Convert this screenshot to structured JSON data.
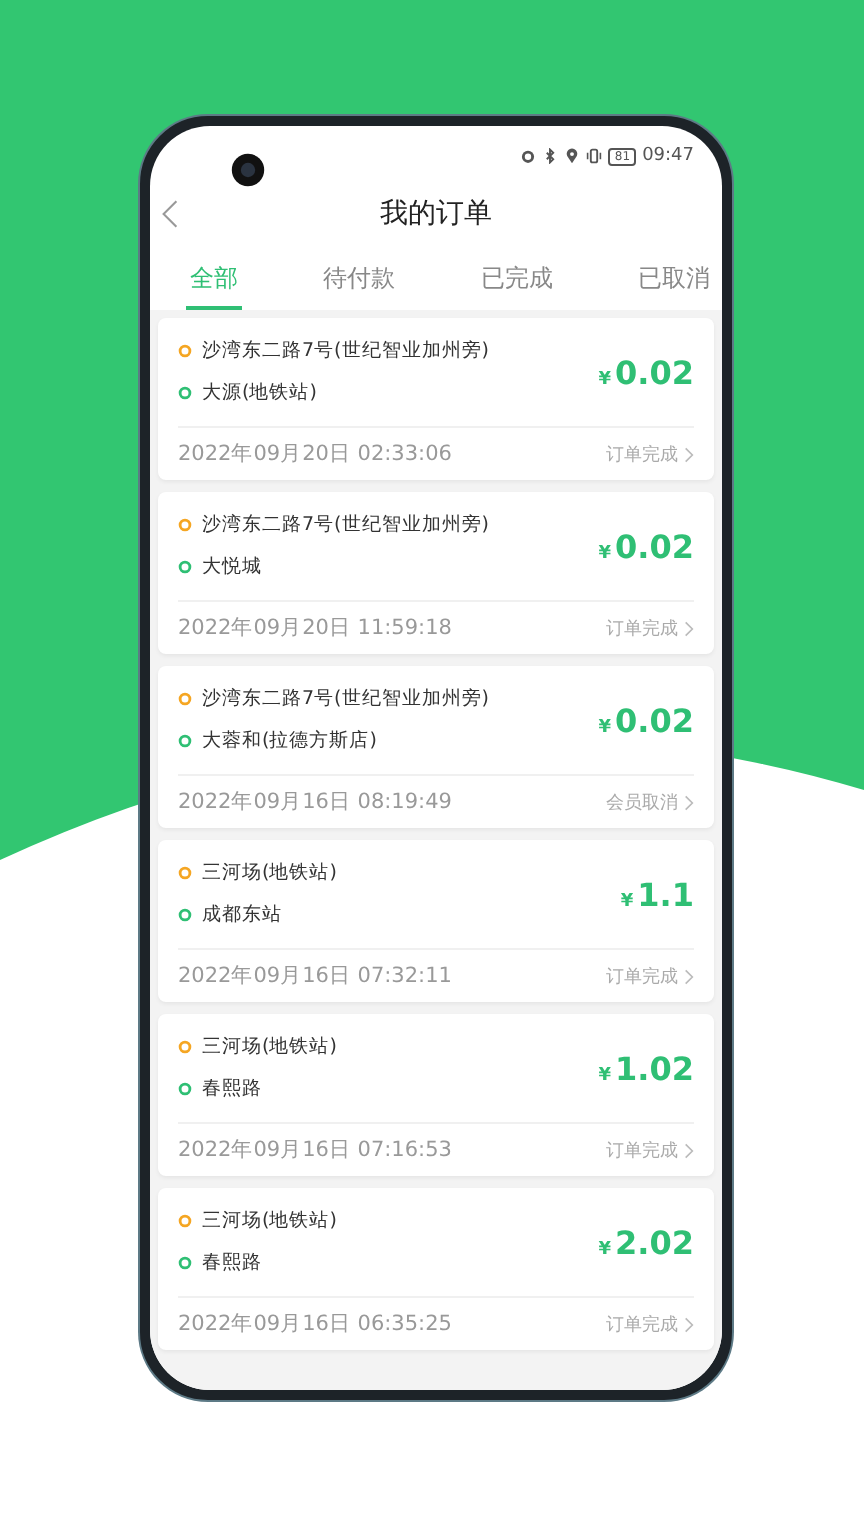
{
  "status_bar": {
    "battery": "81",
    "time": "09:47"
  },
  "header": {
    "title": "我的订单"
  },
  "tabs": [
    {
      "label": "全部",
      "selected": true
    },
    {
      "label": "待付款",
      "selected": false
    },
    {
      "label": "已完成",
      "selected": false
    },
    {
      "label": "已取消",
      "selected": false
    }
  ],
  "orders": [
    {
      "origin": "沙湾东二路7号(世纪智业加州旁)",
      "destination": "大源(地铁站)",
      "currency": "¥",
      "amount": "0.02",
      "datetime": "2022年09月20日 02:33:06",
      "status": "订单完成"
    },
    {
      "origin": "沙湾东二路7号(世纪智业加州旁)",
      "destination": "大悦城",
      "currency": "¥",
      "amount": "0.02",
      "datetime": "2022年09月20日 11:59:18",
      "status": "订单完成"
    },
    {
      "origin": "沙湾东二路7号(世纪智业加州旁)",
      "destination": "大蓉和(拉德方斯店)",
      "currency": "¥",
      "amount": "0.02",
      "datetime": "2022年09月16日 08:19:49",
      "status": "会员取消"
    },
    {
      "origin": "三河场(地铁站)",
      "destination": "成都东站",
      "currency": "¥",
      "amount": "1.1",
      "datetime": "2022年09月16日 07:32:11",
      "status": "订单完成"
    },
    {
      "origin": "三河场(地铁站)",
      "destination": "春熙路",
      "currency": "¥",
      "amount": "1.02",
      "datetime": "2022年09月16日 07:16:53",
      "status": "订单完成"
    },
    {
      "origin": "三河场(地铁站)",
      "destination": "春熙路",
      "currency": "¥",
      "amount": "2.02",
      "datetime": "2022年09月16日 06:35:25",
      "status": "订单完成"
    }
  ]
}
